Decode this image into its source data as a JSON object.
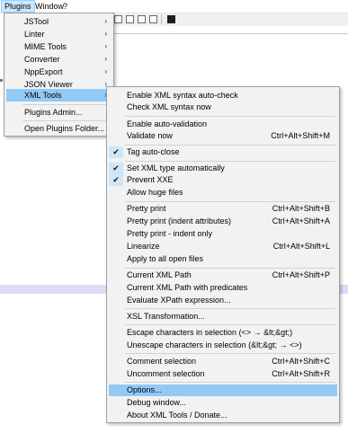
{
  "menubar": [
    "Plugins",
    "Window",
    "?"
  ],
  "toolbar_icons": [
    "document-icon",
    "edit-icon",
    "function-icon",
    "monitor-icon",
    "terminal-icon"
  ],
  "plugins_menu": {
    "items": [
      {
        "label": "JSTool",
        "has_submenu": true
      },
      {
        "label": "Linter",
        "has_submenu": true
      },
      {
        "label": "MIME Tools",
        "has_submenu": true
      },
      {
        "label": "Converter",
        "has_submenu": true
      },
      {
        "label": "NppExport",
        "has_submenu": true
      },
      {
        "label": "JSON Viewer",
        "has_submenu": true
      },
      {
        "label": "XML Tools",
        "has_submenu": true,
        "highlighted": true
      },
      {
        "label": "Plugins Admin...",
        "has_submenu": false
      },
      {
        "label": "Open Plugins Folder...",
        "has_submenu": false
      }
    ]
  },
  "xml_tools_menu": {
    "items": [
      {
        "label": "Enable XML syntax auto-check",
        "shortcut": "",
        "checked": false
      },
      {
        "label": "Check XML syntax now",
        "shortcut": "",
        "checked": false
      },
      {
        "label": "Enable auto-validation",
        "shortcut": "",
        "checked": false
      },
      {
        "label": "Validate now",
        "shortcut": "Ctrl+Alt+Shift+M",
        "checked": false
      },
      {
        "label": "Tag auto-close",
        "shortcut": "",
        "checked": true
      },
      {
        "label": "Set XML type automatically",
        "shortcut": "",
        "checked": true
      },
      {
        "label": "Prevent XXE",
        "shortcut": "",
        "checked": true
      },
      {
        "label": "Allow huge files",
        "shortcut": "",
        "checked": false
      },
      {
        "label": "Pretty print",
        "shortcut": "Ctrl+Alt+Shift+B",
        "checked": false
      },
      {
        "label": "Pretty print (indent attributes)",
        "shortcut": "Ctrl+Alt+Shift+A",
        "checked": false
      },
      {
        "label": "Pretty print - indent only",
        "shortcut": "",
        "checked": false
      },
      {
        "label": "Linearize",
        "shortcut": "Ctrl+Alt+Shift+L",
        "checked": false
      },
      {
        "label": "Apply to all open files",
        "shortcut": "",
        "checked": false
      },
      {
        "label": "Current XML Path",
        "shortcut": "Ctrl+Alt+Shift+P",
        "checked": false
      },
      {
        "label": "Current XML Path with predicates",
        "shortcut": "",
        "checked": false
      },
      {
        "label": "Evaluate XPath expression...",
        "shortcut": "",
        "checked": false
      },
      {
        "label": "XSL Transformation...",
        "shortcut": "",
        "checked": false
      },
      {
        "label": "Escape characters in selection (<> → &lt;&gt;)",
        "shortcut": "",
        "checked": false
      },
      {
        "label": "Unescape characters in selection (&lt;&gt; → <>)",
        "shortcut": "",
        "checked": false
      },
      {
        "label": "Comment selection",
        "shortcut": "Ctrl+Alt+Shift+C",
        "checked": false
      },
      {
        "label": "Uncomment selection",
        "shortcut": "Ctrl+Alt+Shift+R",
        "checked": false
      },
      {
        "label": "Options...",
        "shortcut": "",
        "checked": false,
        "highlighted": true
      },
      {
        "label": "Debug window...",
        "shortcut": "",
        "checked": false
      },
      {
        "label": "About XML Tools / Donate...",
        "shortcut": "",
        "checked": false
      }
    ]
  },
  "colors": {
    "highlight": "#91c9f7",
    "menu_bg": "#f2f2f2",
    "check_bg": "#cfe6f8"
  }
}
